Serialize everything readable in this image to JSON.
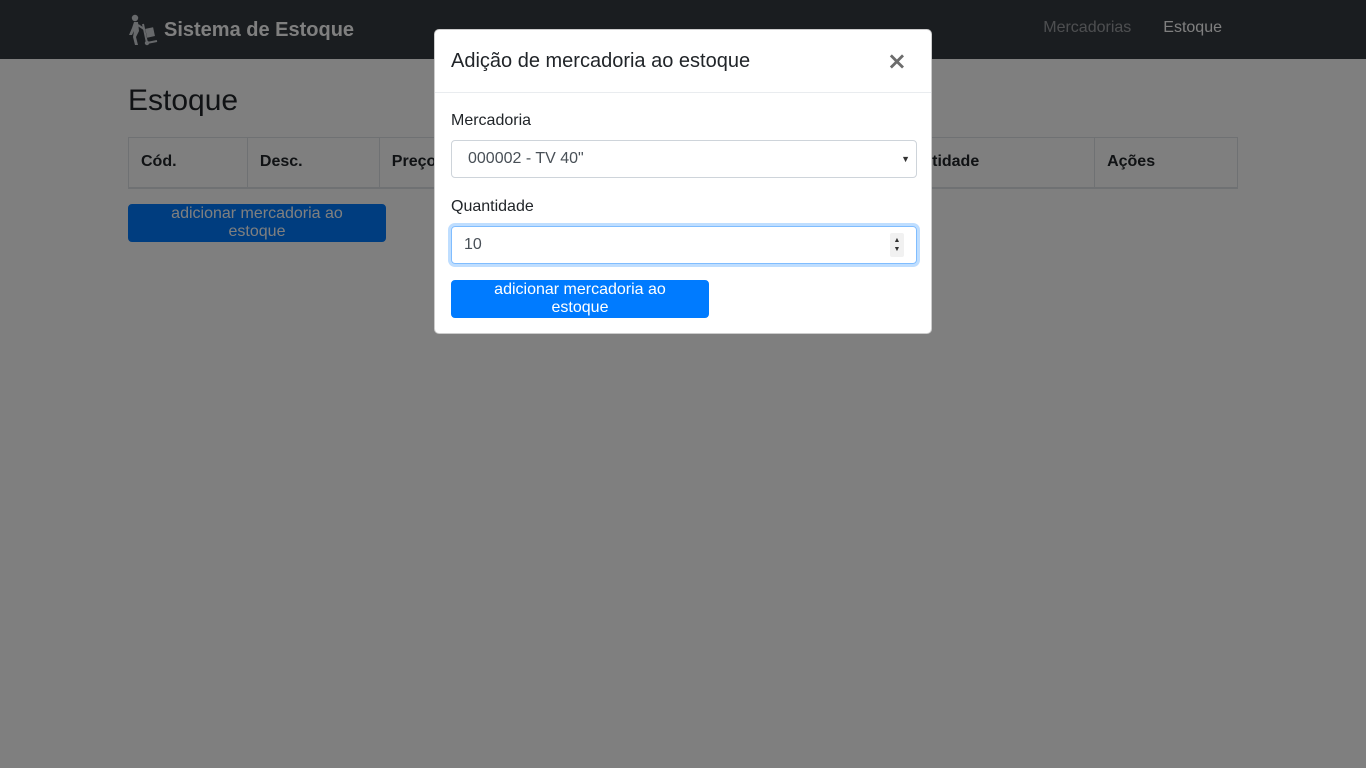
{
  "navbar": {
    "brand": "Sistema de Estoque",
    "brand_icon": "hand-truck-icon",
    "links": [
      {
        "label": "Mercadorias",
        "active": false
      },
      {
        "label": "Estoque",
        "active": true
      }
    ]
  },
  "page": {
    "title": "Estoque",
    "table_headers": [
      "Cód.",
      "Desc.",
      "Preço",
      "",
      "",
      "Quantidade",
      "Ações"
    ],
    "add_button_label": "adicionar mercadoria ao estoque"
  },
  "modal": {
    "title": "Adição de mercadoria ao estoque",
    "close_symbol": "×",
    "mercadoria_label": "Mercadoria",
    "mercadoria_selected": "000002 - TV 40\"",
    "quantidade_label": "Quantidade",
    "quantidade_value": "10",
    "submit_label": "adicionar mercadoria ao estoque"
  },
  "colors": {
    "navbar_bg": "#343a40",
    "primary": "#007bff",
    "backdrop": "rgba(0,0,0,0.5)"
  }
}
